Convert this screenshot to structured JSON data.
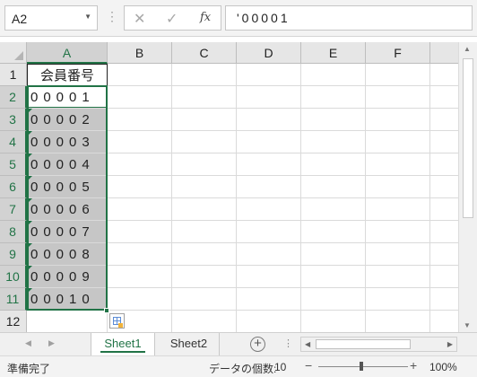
{
  "formula_bar": {
    "name_box": "A2",
    "formula": "'00001"
  },
  "columns": [
    "A",
    "B",
    "C",
    "D",
    "E",
    "F"
  ],
  "rows": [
    "1",
    "2",
    "3",
    "4",
    "5",
    "6",
    "7",
    "8",
    "9",
    "10",
    "11",
    "12"
  ],
  "cells": {
    "a1": "会員番号",
    "a2": "00001",
    "a3": "00002",
    "a4": "00003",
    "a5": "00004",
    "a6": "00005",
    "a7": "00006",
    "a8": "00007",
    "a9": "00008",
    "a10": "00009",
    "a11": "00010"
  },
  "sheet_tabs": [
    "Sheet1",
    "Sheet2"
  ],
  "active_sheet": "Sheet1",
  "status_bar": {
    "ready": "準備完了",
    "count_label": "データの個数:",
    "count_value": "10",
    "zoom": "100%"
  },
  "colors": {
    "accent": "#217346",
    "selection_fill": "#c6c6c6",
    "error_indicator": "#1e7145"
  },
  "icons": [
    "dropdown-arrow-icon",
    "cancel-icon",
    "enter-icon",
    "fx-icon",
    "error-indicator-icon",
    "quick-analysis-icon",
    "add-sheet-icon",
    "zoom-minus-icon",
    "zoom-plus-icon"
  ]
}
